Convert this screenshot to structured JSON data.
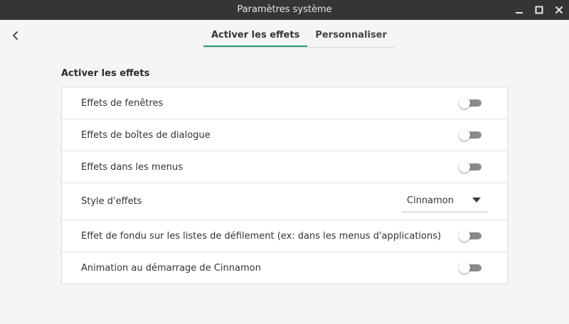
{
  "window": {
    "title": "Paramètres système"
  },
  "header": {
    "tabs": [
      {
        "label": "Activer les effets",
        "active": true
      },
      {
        "label": "Personnaliser",
        "active": false
      }
    ]
  },
  "section": {
    "title": "Activer les effets"
  },
  "settings": {
    "rows": [
      {
        "label": "Effets de fenêtres",
        "control": "toggle",
        "enabled": false
      },
      {
        "label": "Effets de boîtes de dialogue",
        "control": "toggle",
        "enabled": false
      },
      {
        "label": "Effets dans les menus",
        "control": "toggle",
        "enabled": false
      },
      {
        "label": "Style d'effets",
        "control": "dropdown",
        "value": "Cinnamon"
      },
      {
        "label": "Effet de fondu sur les listes de défilement (ex: dans les menus d'applications)",
        "control": "toggle",
        "enabled": false
      },
      {
        "label": "Animation au démarrage de Cinnamon",
        "control": "toggle",
        "enabled": false
      }
    ]
  },
  "icons": {
    "back": "chevron-left-icon",
    "minimize": "minimize-icon",
    "maximize": "maximize-icon",
    "close": "close-icon",
    "dropdown": "caret-down-icon"
  },
  "colors": {
    "titlebar": "#353535",
    "accent": "#2e9d77",
    "toggle_off": "#8a8a8a"
  }
}
